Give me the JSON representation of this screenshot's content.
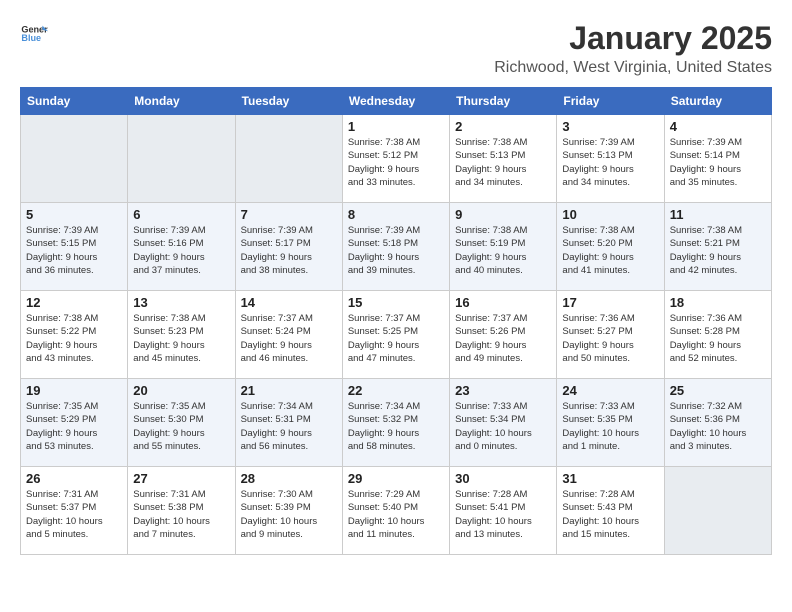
{
  "logo": {
    "line1": "General",
    "line2": "Blue"
  },
  "title": "January 2025",
  "subtitle": "Richwood, West Virginia, United States",
  "days_of_week": [
    "Sunday",
    "Monday",
    "Tuesday",
    "Wednesday",
    "Thursday",
    "Friday",
    "Saturday"
  ],
  "weeks": [
    [
      {
        "day": "",
        "info": ""
      },
      {
        "day": "",
        "info": ""
      },
      {
        "day": "",
        "info": ""
      },
      {
        "day": "1",
        "info": "Sunrise: 7:38 AM\nSunset: 5:12 PM\nDaylight: 9 hours\nand 33 minutes."
      },
      {
        "day": "2",
        "info": "Sunrise: 7:38 AM\nSunset: 5:13 PM\nDaylight: 9 hours\nand 34 minutes."
      },
      {
        "day": "3",
        "info": "Sunrise: 7:39 AM\nSunset: 5:13 PM\nDaylight: 9 hours\nand 34 minutes."
      },
      {
        "day": "4",
        "info": "Sunrise: 7:39 AM\nSunset: 5:14 PM\nDaylight: 9 hours\nand 35 minutes."
      }
    ],
    [
      {
        "day": "5",
        "info": "Sunrise: 7:39 AM\nSunset: 5:15 PM\nDaylight: 9 hours\nand 36 minutes."
      },
      {
        "day": "6",
        "info": "Sunrise: 7:39 AM\nSunset: 5:16 PM\nDaylight: 9 hours\nand 37 minutes."
      },
      {
        "day": "7",
        "info": "Sunrise: 7:39 AM\nSunset: 5:17 PM\nDaylight: 9 hours\nand 38 minutes."
      },
      {
        "day": "8",
        "info": "Sunrise: 7:39 AM\nSunset: 5:18 PM\nDaylight: 9 hours\nand 39 minutes."
      },
      {
        "day": "9",
        "info": "Sunrise: 7:38 AM\nSunset: 5:19 PM\nDaylight: 9 hours\nand 40 minutes."
      },
      {
        "day": "10",
        "info": "Sunrise: 7:38 AM\nSunset: 5:20 PM\nDaylight: 9 hours\nand 41 minutes."
      },
      {
        "day": "11",
        "info": "Sunrise: 7:38 AM\nSunset: 5:21 PM\nDaylight: 9 hours\nand 42 minutes."
      }
    ],
    [
      {
        "day": "12",
        "info": "Sunrise: 7:38 AM\nSunset: 5:22 PM\nDaylight: 9 hours\nand 43 minutes."
      },
      {
        "day": "13",
        "info": "Sunrise: 7:38 AM\nSunset: 5:23 PM\nDaylight: 9 hours\nand 45 minutes."
      },
      {
        "day": "14",
        "info": "Sunrise: 7:37 AM\nSunset: 5:24 PM\nDaylight: 9 hours\nand 46 minutes."
      },
      {
        "day": "15",
        "info": "Sunrise: 7:37 AM\nSunset: 5:25 PM\nDaylight: 9 hours\nand 47 minutes."
      },
      {
        "day": "16",
        "info": "Sunrise: 7:37 AM\nSunset: 5:26 PM\nDaylight: 9 hours\nand 49 minutes."
      },
      {
        "day": "17",
        "info": "Sunrise: 7:36 AM\nSunset: 5:27 PM\nDaylight: 9 hours\nand 50 minutes."
      },
      {
        "day": "18",
        "info": "Sunrise: 7:36 AM\nSunset: 5:28 PM\nDaylight: 9 hours\nand 52 minutes."
      }
    ],
    [
      {
        "day": "19",
        "info": "Sunrise: 7:35 AM\nSunset: 5:29 PM\nDaylight: 9 hours\nand 53 minutes."
      },
      {
        "day": "20",
        "info": "Sunrise: 7:35 AM\nSunset: 5:30 PM\nDaylight: 9 hours\nand 55 minutes."
      },
      {
        "day": "21",
        "info": "Sunrise: 7:34 AM\nSunset: 5:31 PM\nDaylight: 9 hours\nand 56 minutes."
      },
      {
        "day": "22",
        "info": "Sunrise: 7:34 AM\nSunset: 5:32 PM\nDaylight: 9 hours\nand 58 minutes."
      },
      {
        "day": "23",
        "info": "Sunrise: 7:33 AM\nSunset: 5:34 PM\nDaylight: 10 hours\nand 0 minutes."
      },
      {
        "day": "24",
        "info": "Sunrise: 7:33 AM\nSunset: 5:35 PM\nDaylight: 10 hours\nand 1 minute."
      },
      {
        "day": "25",
        "info": "Sunrise: 7:32 AM\nSunset: 5:36 PM\nDaylight: 10 hours\nand 3 minutes."
      }
    ],
    [
      {
        "day": "26",
        "info": "Sunrise: 7:31 AM\nSunset: 5:37 PM\nDaylight: 10 hours\nand 5 minutes."
      },
      {
        "day": "27",
        "info": "Sunrise: 7:31 AM\nSunset: 5:38 PM\nDaylight: 10 hours\nand 7 minutes."
      },
      {
        "day": "28",
        "info": "Sunrise: 7:30 AM\nSunset: 5:39 PM\nDaylight: 10 hours\nand 9 minutes."
      },
      {
        "day": "29",
        "info": "Sunrise: 7:29 AM\nSunset: 5:40 PM\nDaylight: 10 hours\nand 11 minutes."
      },
      {
        "day": "30",
        "info": "Sunrise: 7:28 AM\nSunset: 5:41 PM\nDaylight: 10 hours\nand 13 minutes."
      },
      {
        "day": "31",
        "info": "Sunrise: 7:28 AM\nSunset: 5:43 PM\nDaylight: 10 hours\nand 15 minutes."
      },
      {
        "day": "",
        "info": ""
      }
    ]
  ]
}
